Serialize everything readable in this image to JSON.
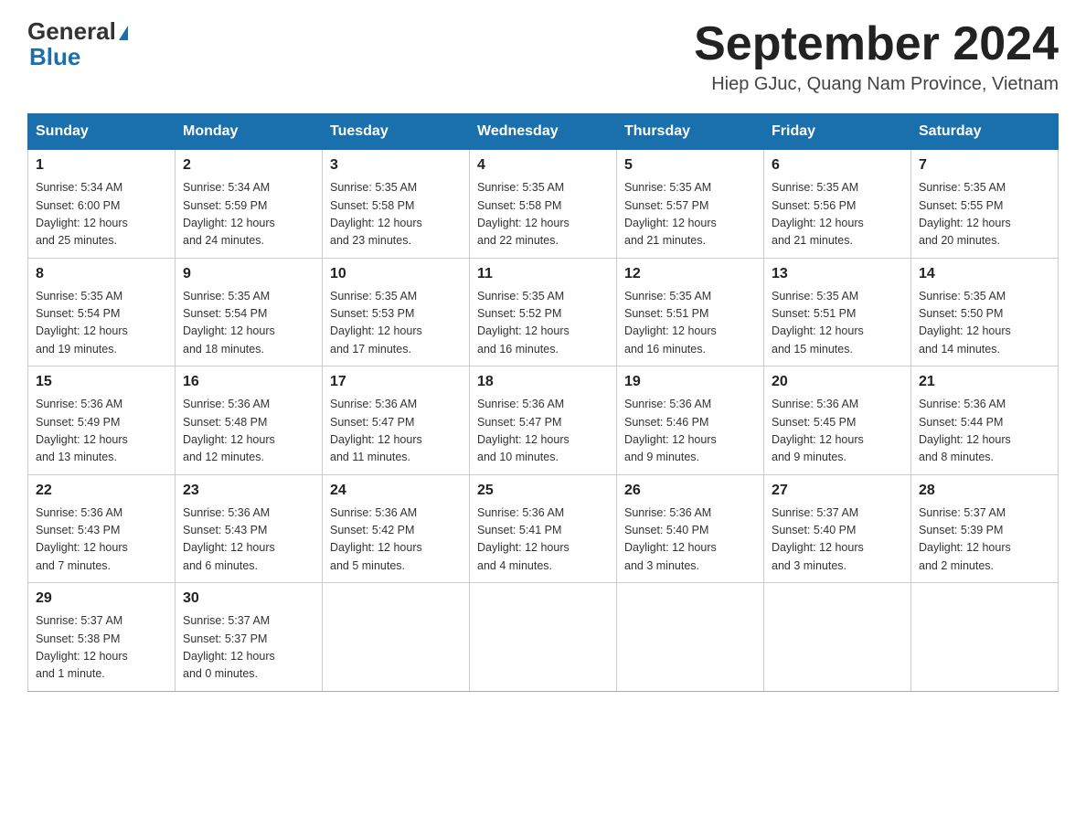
{
  "header": {
    "logo_line1": "General",
    "logo_line2": "Blue",
    "month_title": "September 2024",
    "location": "Hiep GJuc, Quang Nam Province, Vietnam"
  },
  "days_of_week": [
    "Sunday",
    "Monday",
    "Tuesday",
    "Wednesday",
    "Thursday",
    "Friday",
    "Saturday"
  ],
  "weeks": [
    [
      {
        "day": "1",
        "sunrise": "5:34 AM",
        "sunset": "6:00 PM",
        "daylight": "12 hours and 25 minutes."
      },
      {
        "day": "2",
        "sunrise": "5:34 AM",
        "sunset": "5:59 PM",
        "daylight": "12 hours and 24 minutes."
      },
      {
        "day": "3",
        "sunrise": "5:35 AM",
        "sunset": "5:58 PM",
        "daylight": "12 hours and 23 minutes."
      },
      {
        "day": "4",
        "sunrise": "5:35 AM",
        "sunset": "5:58 PM",
        "daylight": "12 hours and 22 minutes."
      },
      {
        "day": "5",
        "sunrise": "5:35 AM",
        "sunset": "5:57 PM",
        "daylight": "12 hours and 21 minutes."
      },
      {
        "day": "6",
        "sunrise": "5:35 AM",
        "sunset": "5:56 PM",
        "daylight": "12 hours and 21 minutes."
      },
      {
        "day": "7",
        "sunrise": "5:35 AM",
        "sunset": "5:55 PM",
        "daylight": "12 hours and 20 minutes."
      }
    ],
    [
      {
        "day": "8",
        "sunrise": "5:35 AM",
        "sunset": "5:54 PM",
        "daylight": "12 hours and 19 minutes."
      },
      {
        "day": "9",
        "sunrise": "5:35 AM",
        "sunset": "5:54 PM",
        "daylight": "12 hours and 18 minutes."
      },
      {
        "day": "10",
        "sunrise": "5:35 AM",
        "sunset": "5:53 PM",
        "daylight": "12 hours and 17 minutes."
      },
      {
        "day": "11",
        "sunrise": "5:35 AM",
        "sunset": "5:52 PM",
        "daylight": "12 hours and 16 minutes."
      },
      {
        "day": "12",
        "sunrise": "5:35 AM",
        "sunset": "5:51 PM",
        "daylight": "12 hours and 16 minutes."
      },
      {
        "day": "13",
        "sunrise": "5:35 AM",
        "sunset": "5:51 PM",
        "daylight": "12 hours and 15 minutes."
      },
      {
        "day": "14",
        "sunrise": "5:35 AM",
        "sunset": "5:50 PM",
        "daylight": "12 hours and 14 minutes."
      }
    ],
    [
      {
        "day": "15",
        "sunrise": "5:36 AM",
        "sunset": "5:49 PM",
        "daylight": "12 hours and 13 minutes."
      },
      {
        "day": "16",
        "sunrise": "5:36 AM",
        "sunset": "5:48 PM",
        "daylight": "12 hours and 12 minutes."
      },
      {
        "day": "17",
        "sunrise": "5:36 AM",
        "sunset": "5:47 PM",
        "daylight": "12 hours and 11 minutes."
      },
      {
        "day": "18",
        "sunrise": "5:36 AM",
        "sunset": "5:47 PM",
        "daylight": "12 hours and 10 minutes."
      },
      {
        "day": "19",
        "sunrise": "5:36 AM",
        "sunset": "5:46 PM",
        "daylight": "12 hours and 9 minutes."
      },
      {
        "day": "20",
        "sunrise": "5:36 AM",
        "sunset": "5:45 PM",
        "daylight": "12 hours and 9 minutes."
      },
      {
        "day": "21",
        "sunrise": "5:36 AM",
        "sunset": "5:44 PM",
        "daylight": "12 hours and 8 minutes."
      }
    ],
    [
      {
        "day": "22",
        "sunrise": "5:36 AM",
        "sunset": "5:43 PM",
        "daylight": "12 hours and 7 minutes."
      },
      {
        "day": "23",
        "sunrise": "5:36 AM",
        "sunset": "5:43 PM",
        "daylight": "12 hours and 6 minutes."
      },
      {
        "day": "24",
        "sunrise": "5:36 AM",
        "sunset": "5:42 PM",
        "daylight": "12 hours and 5 minutes."
      },
      {
        "day": "25",
        "sunrise": "5:36 AM",
        "sunset": "5:41 PM",
        "daylight": "12 hours and 4 minutes."
      },
      {
        "day": "26",
        "sunrise": "5:36 AM",
        "sunset": "5:40 PM",
        "daylight": "12 hours and 3 minutes."
      },
      {
        "day": "27",
        "sunrise": "5:37 AM",
        "sunset": "5:40 PM",
        "daylight": "12 hours and 3 minutes."
      },
      {
        "day": "28",
        "sunrise": "5:37 AM",
        "sunset": "5:39 PM",
        "daylight": "12 hours and 2 minutes."
      }
    ],
    [
      {
        "day": "29",
        "sunrise": "5:37 AM",
        "sunset": "5:38 PM",
        "daylight": "12 hours and 1 minute."
      },
      {
        "day": "30",
        "sunrise": "5:37 AM",
        "sunset": "5:37 PM",
        "daylight": "12 hours and 0 minutes."
      },
      null,
      null,
      null,
      null,
      null
    ]
  ],
  "labels": {
    "sunrise_prefix": "Sunrise: ",
    "sunset_prefix": "Sunset: ",
    "daylight_prefix": "Daylight: "
  }
}
